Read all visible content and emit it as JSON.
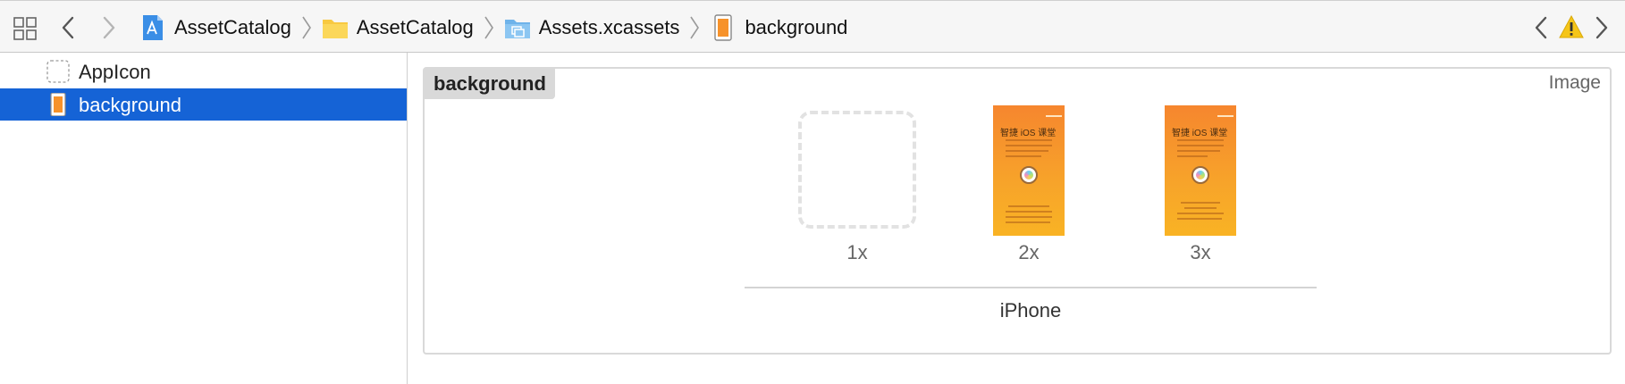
{
  "jumpbar": {
    "breadcrumbs": [
      {
        "label": "AssetCatalog",
        "icon": "xcode-project-icon"
      },
      {
        "label": "AssetCatalog",
        "icon": "folder-icon"
      },
      {
        "label": "Assets.xcassets",
        "icon": "asset-catalog-icon"
      },
      {
        "label": "background",
        "icon": "image-set-icon"
      }
    ],
    "warning_icon": "warning-icon"
  },
  "sidebar": {
    "items": [
      {
        "label": "AppIcon",
        "icon": "app-icon-set-icon",
        "selected": false
      },
      {
        "label": "background",
        "icon": "image-set-icon",
        "selected": true
      }
    ]
  },
  "editor": {
    "set_name": "background",
    "set_type": "Image",
    "slots": [
      {
        "scale": "1x",
        "filled": false
      },
      {
        "scale": "2x",
        "filled": true,
        "thumb_heading": "智捷 iOS 课堂"
      },
      {
        "scale": "3x",
        "filled": true,
        "thumb_heading": "智捷 iOS 课堂"
      }
    ],
    "idiom": "iPhone"
  },
  "colors": {
    "selection": "#1563d6",
    "accent_blue": "#3a8ee6",
    "folder_yellow": "#f8c941",
    "warning_yellow": "#f5c518",
    "thumb_orange": "#f7922a"
  }
}
